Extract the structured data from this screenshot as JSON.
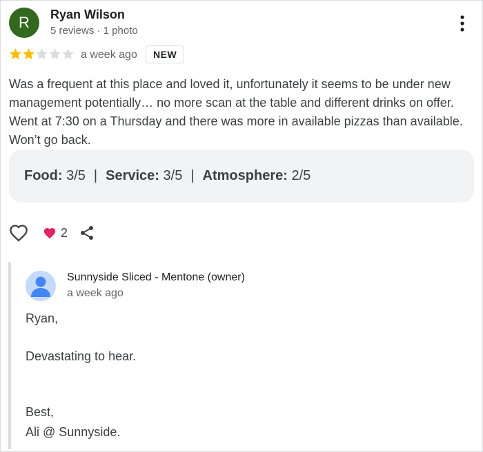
{
  "review": {
    "avatar_letter": "R",
    "avatar_color": "#33691e",
    "reviewer_name": "Ryan Wilson",
    "reviewer_meta": "5 reviews · 1 photo",
    "rating": 2,
    "rating_max": 5,
    "star_color_filled": "#fbbc04",
    "star_color_empty": "#dadce0",
    "date": "a week ago",
    "badge": "NEW",
    "text": "Was a frequent at this place and loved it, unfortunately it seems to be under new management potentially… no more scan at the table and different drinks on offer. Went at 7:30 on a Thursday and there was more in available pizzas than available. Won’t go back."
  },
  "ratings": {
    "food_label": "Food:",
    "food_value": "3/5",
    "service_label": "Service:",
    "service_value": "3/5",
    "atmosphere_label": "Atmosphere:",
    "atmosphere_value": "2/5",
    "separator": "|"
  },
  "actions": {
    "like_icon": "heart-outline-icon",
    "reaction_icon": "heart-filled-icon",
    "reaction_count": "2",
    "share_icon": "share-icon"
  },
  "owner_reply": {
    "name": "Sunnyside Sliced - Mentone (owner)",
    "date": "a week ago",
    "lines": [
      "Ryan,",
      "Devastating to hear.",
      "Best,",
      "Ali @ Sunnyside."
    ]
  }
}
